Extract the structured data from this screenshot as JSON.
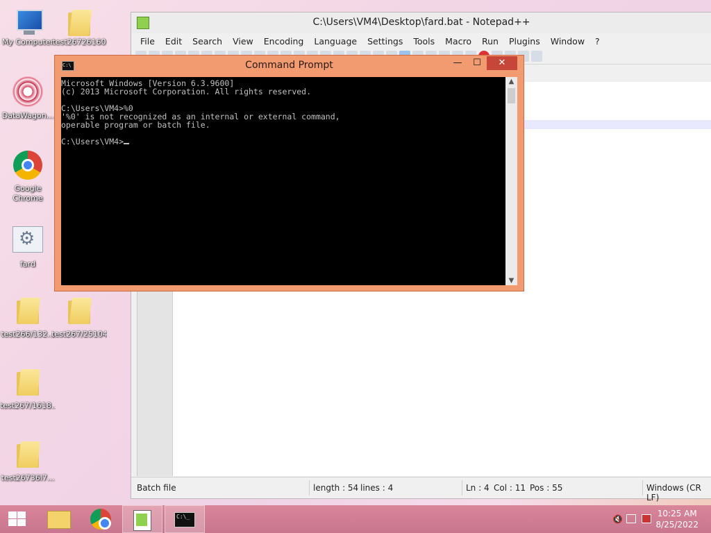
{
  "desktop": {
    "icons": [
      {
        "label": "My Computer"
      },
      {
        "label": "test26726160"
      },
      {
        "label": "DataWagon..."
      },
      {
        "label": "Google Chrome"
      },
      {
        "label": "fard"
      },
      {
        "label": "test266/132..."
      },
      {
        "label": "test267/25104"
      },
      {
        "label": "test267/1618..."
      },
      {
        "label": "test26736l7..."
      }
    ]
  },
  "notepadpp": {
    "title": "C:\\Users\\VM4\\Desktop\\fard.bat - Notepad++",
    "menu": [
      "File",
      "Edit",
      "Search",
      "View",
      "Encoding",
      "Language",
      "Settings",
      "Tools",
      "Macro",
      "Run",
      "Plugins",
      "Window",
      "?"
    ],
    "status": {
      "filetype": "Batch file",
      "length": "length : 54",
      "lines": "lines : 4",
      "ln": "Ln : 4",
      "col": "Col : 11",
      "pos": "Pos : 55",
      "eol": "Windows (CR LF)"
    }
  },
  "cmd": {
    "title": "Command Prompt",
    "minimize": "—",
    "maximize": "☐",
    "close": "✕",
    "output": "Microsoft Windows [Version 6.3.9600]\n(c) 2013 Microsoft Corporation. All rights reserved.\n\nC:\\Users\\VM4>%0\n'%0' is not recognized as an internal or external command,\noperable program or batch file.\n\nC:\\Users\\VM4>"
  },
  "taskbar": {
    "time": "10:25 AM",
    "date": "8/25/2022"
  }
}
